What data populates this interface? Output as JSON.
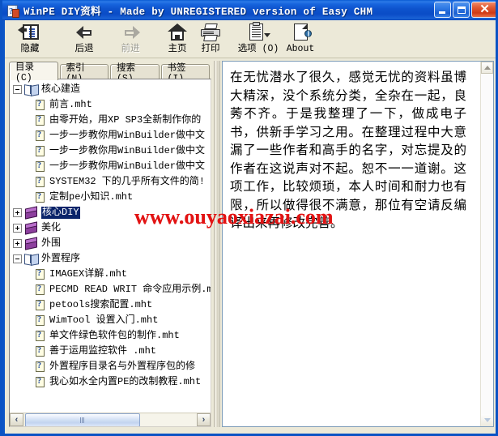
{
  "window": {
    "title": "WinPE DIY资料 - Made by UNREGISTERED version of Easy CHM",
    "icon": "chm-help-icon",
    "minimize_label": "最小化",
    "maximize_label": "最大化",
    "close_label": "关闭"
  },
  "toolbar": {
    "buttons": [
      {
        "label": "隐藏",
        "icon": "hide-panel-icon",
        "disabled": false
      },
      {
        "label": "后退",
        "icon": "back-arrow-icon",
        "disabled": false
      },
      {
        "label": "前进",
        "icon": "forward-arrow-icon",
        "disabled": true
      },
      {
        "label": "主页",
        "icon": "home-icon",
        "disabled": false
      },
      {
        "label": "打印",
        "icon": "printer-icon",
        "disabled": false
      },
      {
        "label": "选项 (O)",
        "icon": "options-icon",
        "disabled": false
      },
      {
        "label": "About",
        "icon": "about-icon",
        "disabled": false
      }
    ]
  },
  "nav": {
    "tabs": [
      {
        "label": "目录 (C)",
        "active": true
      },
      {
        "label": "索引 (N)",
        "active": false
      },
      {
        "label": "搜索 (S)",
        "active": false
      },
      {
        "label": "书签 (I)",
        "active": false
      }
    ],
    "tree": [
      {
        "level": 0,
        "expander": "minus",
        "icon": "open-book-icon",
        "label": "核心建造",
        "selected": false
      },
      {
        "level": 1,
        "expander": "none",
        "icon": "page-help-icon",
        "label": "前言.mht",
        "selected": false
      },
      {
        "level": 1,
        "expander": "none",
        "icon": "page-help-icon",
        "label": "由零开始，用XP SP3全新制作你的",
        "selected": false
      },
      {
        "level": 1,
        "expander": "none",
        "icon": "page-help-icon",
        "label": "一步一步教你用WinBuilder做中文",
        "selected": false
      },
      {
        "level": 1,
        "expander": "none",
        "icon": "page-help-icon",
        "label": "一步一步教你用WinBuilder做中文",
        "selected": false
      },
      {
        "level": 1,
        "expander": "none",
        "icon": "page-help-icon",
        "label": "一步一步教你用WinBuilder做中文",
        "selected": false
      },
      {
        "level": 1,
        "expander": "none",
        "icon": "page-help-icon",
        "label": "SYSTEM32 下的几乎所有文件的简!",
        "selected": false
      },
      {
        "level": 1,
        "expander": "none",
        "icon": "page-help-icon",
        "label": "定制pe小知识.mht",
        "selected": false
      },
      {
        "level": 0,
        "expander": "plus",
        "icon": "closed-book-icon",
        "label": "核心DIY",
        "selected": true
      },
      {
        "level": 0,
        "expander": "plus",
        "icon": "closed-book-icon",
        "label": "美化",
        "selected": false
      },
      {
        "level": 0,
        "expander": "plus",
        "icon": "closed-book-icon",
        "label": "外围",
        "selected": false
      },
      {
        "level": 0,
        "expander": "minus",
        "icon": "open-book-icon",
        "label": "外置程序",
        "selected": false
      },
      {
        "level": 1,
        "expander": "none",
        "icon": "page-help-icon",
        "label": "IMAGEX详解.mht",
        "selected": false
      },
      {
        "level": 1,
        "expander": "none",
        "icon": "page-help-icon",
        "label": "PECMD READ WRIT 命令应用示例.m",
        "selected": false
      },
      {
        "level": 1,
        "expander": "none",
        "icon": "page-help-icon",
        "label": "petools搜索配置.mht",
        "selected": false
      },
      {
        "level": 1,
        "expander": "none",
        "icon": "page-help-icon",
        "label": "WimTool 设置入门.mht",
        "selected": false
      },
      {
        "level": 1,
        "expander": "none",
        "icon": "page-help-icon",
        "label": "单文件绿色软件包的制作.mht",
        "selected": false
      },
      {
        "level": 1,
        "expander": "none",
        "icon": "page-help-icon",
        "label": "善于运用监控软件  .mht",
        "selected": false
      },
      {
        "level": 1,
        "expander": "none",
        "icon": "page-help-icon",
        "label": "外置程序目录名与外置程序包的修",
        "selected": false
      },
      {
        "level": 1,
        "expander": "none",
        "icon": "page-help-icon",
        "label": "我心如水全内置PE的改制教程.mht",
        "selected": false
      }
    ],
    "hscroll": {
      "left_arrow": "‹",
      "right_arrow": "›"
    }
  },
  "content": {
    "body": "在无忧潜水了很久，感觉无忧的资料虽博大精深，没个系统分类，全杂在一起，良莠不齐。于是我整理了一下，做成电子书，供新手学习之用。在整理过程中大意漏了一些作者和高手的名字，对忘提及的作者在这说声对不起。恕不一一道谢。这项工作，比较烦琐，本人时间和耐力也有限，所以做得很不满意，那位有空请反编译出来再修改完善。",
    "vscroll": {
      "up_arrow": "▲",
      "down_arrow": "▼"
    }
  },
  "watermark": {
    "text": "www.ouyaoxiazai.com",
    "color": "#e21313"
  },
  "colors": {
    "titlebar": "#0a4cc6",
    "window_border": "#0b53c4",
    "toolbar_bg": "#ece9d8",
    "selection": "#0a246a",
    "pane_bg": "#ffffff"
  }
}
